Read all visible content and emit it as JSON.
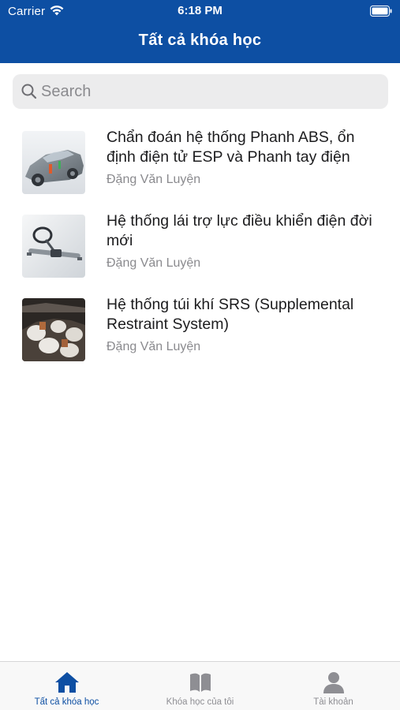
{
  "status_bar": {
    "carrier": "Carrier",
    "time": "6:18 PM"
  },
  "nav": {
    "title": "Tất cả khóa học"
  },
  "search": {
    "placeholder": "Search",
    "value": ""
  },
  "courses": [
    {
      "title": "Chẩn đoán hệ thống Phanh ABS, ổn định điện tử ESP và Phanh tay điện",
      "author": "Đặng Văn Luyện",
      "thumbnail": "car-brake-system"
    },
    {
      "title": "Hệ thống lái trợ lực điều khiển điện đời mới",
      "author": "Đặng Văn Luyện",
      "thumbnail": "electric-power-steering"
    },
    {
      "title": "Hệ thống túi khí SRS (Supplemental Restraint System)",
      "author": "Đặng Văn Luyện",
      "thumbnail": "airbag-system"
    }
  ],
  "tabs": [
    {
      "label": "Tất cả khóa học",
      "icon": "home-icon",
      "active": true
    },
    {
      "label": "Khóa học của tôi",
      "icon": "book-icon",
      "active": false
    },
    {
      "label": "Tài khoản",
      "icon": "user-icon",
      "active": false
    }
  ],
  "colors": {
    "primary": "#0d4fa3",
    "inactive_tab": "#8e8e93",
    "search_bg": "#ececed"
  }
}
